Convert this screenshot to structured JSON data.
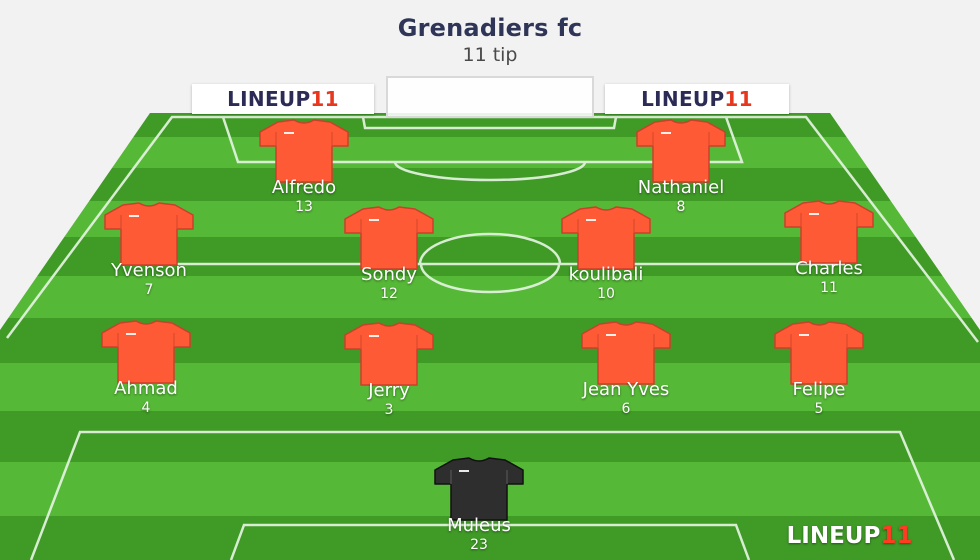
{
  "header": {
    "title": "Grenadiers fc",
    "subtitle": "11 tip"
  },
  "brand": {
    "logo_white_part": "LINEUP",
    "logo_red_part": "11",
    "logo_dark_color": "#2b2b55",
    "logo_red_color": "#e8371f"
  },
  "colors": {
    "pitch_dark": "#3f9a26",
    "pitch_light": "#56b837",
    "field_player_shirt": "#ff5a36",
    "goalkeeper_shirt": "#2e2e2e"
  },
  "players": [
    {
      "name": "Alfredo",
      "number": "13",
      "role": "field"
    },
    {
      "name": "Nathaniel",
      "number": "8",
      "role": "field"
    },
    {
      "name": "Yvenson",
      "number": "7",
      "role": "field"
    },
    {
      "name": "Sondy",
      "number": "12",
      "role": "field"
    },
    {
      "name": "koulibali",
      "number": "10",
      "role": "field"
    },
    {
      "name": "Charles",
      "number": "11",
      "role": "field"
    },
    {
      "name": "Ahmad",
      "number": "4",
      "role": "field"
    },
    {
      "name": "Jerry",
      "number": "3",
      "role": "field"
    },
    {
      "name": "Jean Yves",
      "number": "6",
      "role": "field"
    },
    {
      "name": "Felipe",
      "number": "5",
      "role": "field"
    },
    {
      "name": "Muleus",
      "number": "23",
      "role": "goalkeeper"
    }
  ]
}
